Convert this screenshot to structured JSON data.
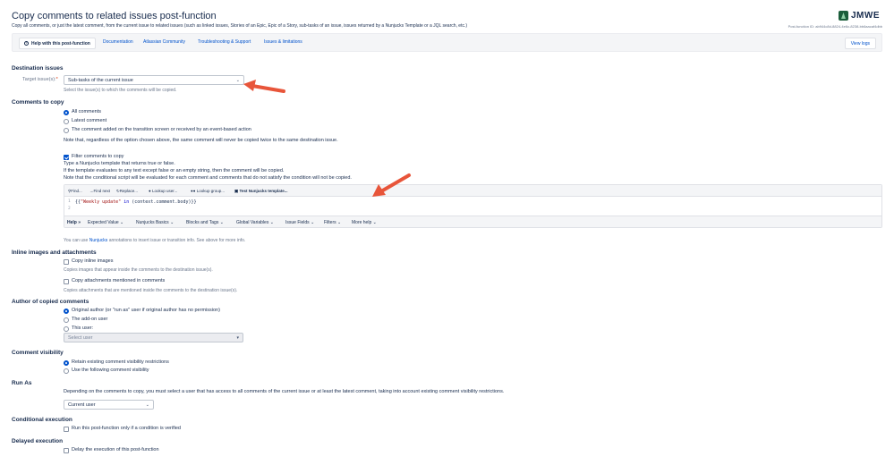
{
  "header": {
    "title": "Copy comments to related issues post-function",
    "subtitle": "Copy all comments, or just the latest comment, from the current issue to related issues (such as linked issues, Stories of an Epic, Epic of a Story, sub-tasks of an issue, issues returned by a Nunjucks Template or a JQL search, etc.)",
    "brand": "JMWE",
    "function_id": "Post-function ID: ab944c8d-8824-4e6c-8238-bb6aacaf4dbb"
  },
  "helpbar": {
    "help_tab": "Help with this post-function",
    "links": [
      "Documentation",
      "Atlassian Community",
      "Troubleshooting & Support",
      "Issues & limitations"
    ],
    "view_logs": "View logs"
  },
  "destination": {
    "heading": "Destination issues",
    "label": "Target issue(s):",
    "required_mark": "*",
    "value": "Sub-tasks of the current issue",
    "hint": "Select the issue(s) to which the comments will be copied."
  },
  "comments": {
    "heading": "Comments to copy",
    "options": [
      "All comments",
      "Latest comment",
      "The comment added on the transition screen or received by an event-based action"
    ],
    "note": "Note that, regardless of the option chosen above, the same comment will never be copied twice to the same destination issue.",
    "filter_label": "Filter comments to copy",
    "filter_lines": [
      "Type a Nunjucks template that returns true or false.",
      "If the template evaluates to any text except false or an empty string, then the comment will be copied.",
      "Note that the conditional script will be evaluated for each comment and comments that do not satisfy the condition will not be copied."
    ]
  },
  "editor": {
    "toolbar": [
      "Find...",
      "Find next",
      "Replace...",
      "Lookup user...",
      "Lookup group...",
      "Test Nunjucks template..."
    ],
    "code_open": "{{",
    "code_string": "\"Weekly update\"",
    "code_kw": "in",
    "code_rest": "(context.comment.body)}}",
    "line_numbers": [
      "1",
      "2"
    ],
    "footer_help": "Help »",
    "footer_menus": [
      "Expected Value",
      "Nunjucks Basics",
      "Blocks and Tags",
      "Global Variables",
      "Issue Fields",
      "Filters",
      "More help"
    ],
    "note_prefix": "You can use ",
    "note_link": "Nunjucks",
    "note_suffix": " annotations to insert issue or transition info. See above for more info."
  },
  "inline": {
    "heading": "Inline images and attachments",
    "opt1": "Copy inline images",
    "hint1": "Copies images that appear inside the comments to the destination issue(s).",
    "opt2": "Copy attachments mentioned in comments",
    "hint2": "Copies attachments that are mentioned inside the comments to the destination issue(s)."
  },
  "author": {
    "heading": "Author of copied comments",
    "options": [
      "Original author (or \"run as\" user if original author has no permission)",
      "The add-on user",
      "This user:"
    ],
    "select_placeholder": "Select user"
  },
  "visibility": {
    "heading": "Comment visibility",
    "options": [
      "Retain existing comment visibility restrictions",
      "Use the following comment visibility"
    ]
  },
  "run_as": {
    "heading": "Run As",
    "text": "Depending on the comments to copy, you must select a user that has access to all comments of the current issue or at least the latest comment, taking into account existing comment visibility restrictions.",
    "value": "Current user"
  },
  "conditional": {
    "heading": "Conditional execution",
    "option": "Run this post-function only if a condition is verified"
  },
  "delayed": {
    "heading": "Delayed execution",
    "option": "Delay the execution of this post-function"
  },
  "colors": {
    "link": "#0052cc",
    "arrow": "#e8553a",
    "accent": "#0052cc"
  }
}
